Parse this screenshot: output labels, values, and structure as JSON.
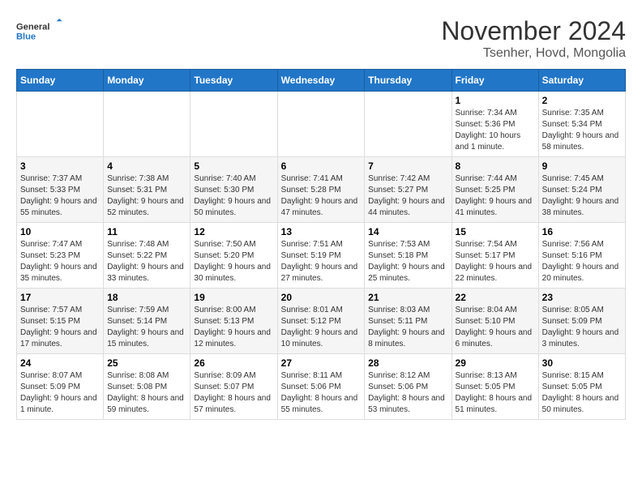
{
  "header": {
    "logo_line1": "General",
    "logo_line2": "Blue",
    "month": "November 2024",
    "location": "Tsenher, Hovd, Mongolia"
  },
  "weekdays": [
    "Sunday",
    "Monday",
    "Tuesday",
    "Wednesday",
    "Thursday",
    "Friday",
    "Saturday"
  ],
  "weeks": [
    [
      {
        "day": "",
        "info": ""
      },
      {
        "day": "",
        "info": ""
      },
      {
        "day": "",
        "info": ""
      },
      {
        "day": "",
        "info": ""
      },
      {
        "day": "",
        "info": ""
      },
      {
        "day": "1",
        "info": "Sunrise: 7:34 AM\nSunset: 5:36 PM\nDaylight: 10 hours and 1 minute."
      },
      {
        "day": "2",
        "info": "Sunrise: 7:35 AM\nSunset: 5:34 PM\nDaylight: 9 hours and 58 minutes."
      }
    ],
    [
      {
        "day": "3",
        "info": "Sunrise: 7:37 AM\nSunset: 5:33 PM\nDaylight: 9 hours and 55 minutes."
      },
      {
        "day": "4",
        "info": "Sunrise: 7:38 AM\nSunset: 5:31 PM\nDaylight: 9 hours and 52 minutes."
      },
      {
        "day": "5",
        "info": "Sunrise: 7:40 AM\nSunset: 5:30 PM\nDaylight: 9 hours and 50 minutes."
      },
      {
        "day": "6",
        "info": "Sunrise: 7:41 AM\nSunset: 5:28 PM\nDaylight: 9 hours and 47 minutes."
      },
      {
        "day": "7",
        "info": "Sunrise: 7:42 AM\nSunset: 5:27 PM\nDaylight: 9 hours and 44 minutes."
      },
      {
        "day": "8",
        "info": "Sunrise: 7:44 AM\nSunset: 5:25 PM\nDaylight: 9 hours and 41 minutes."
      },
      {
        "day": "9",
        "info": "Sunrise: 7:45 AM\nSunset: 5:24 PM\nDaylight: 9 hours and 38 minutes."
      }
    ],
    [
      {
        "day": "10",
        "info": "Sunrise: 7:47 AM\nSunset: 5:23 PM\nDaylight: 9 hours and 35 minutes."
      },
      {
        "day": "11",
        "info": "Sunrise: 7:48 AM\nSunset: 5:22 PM\nDaylight: 9 hours and 33 minutes."
      },
      {
        "day": "12",
        "info": "Sunrise: 7:50 AM\nSunset: 5:20 PM\nDaylight: 9 hours and 30 minutes."
      },
      {
        "day": "13",
        "info": "Sunrise: 7:51 AM\nSunset: 5:19 PM\nDaylight: 9 hours and 27 minutes."
      },
      {
        "day": "14",
        "info": "Sunrise: 7:53 AM\nSunset: 5:18 PM\nDaylight: 9 hours and 25 minutes."
      },
      {
        "day": "15",
        "info": "Sunrise: 7:54 AM\nSunset: 5:17 PM\nDaylight: 9 hours and 22 minutes."
      },
      {
        "day": "16",
        "info": "Sunrise: 7:56 AM\nSunset: 5:16 PM\nDaylight: 9 hours and 20 minutes."
      }
    ],
    [
      {
        "day": "17",
        "info": "Sunrise: 7:57 AM\nSunset: 5:15 PM\nDaylight: 9 hours and 17 minutes."
      },
      {
        "day": "18",
        "info": "Sunrise: 7:59 AM\nSunset: 5:14 PM\nDaylight: 9 hours and 15 minutes."
      },
      {
        "day": "19",
        "info": "Sunrise: 8:00 AM\nSunset: 5:13 PM\nDaylight: 9 hours and 12 minutes."
      },
      {
        "day": "20",
        "info": "Sunrise: 8:01 AM\nSunset: 5:12 PM\nDaylight: 9 hours and 10 minutes."
      },
      {
        "day": "21",
        "info": "Sunrise: 8:03 AM\nSunset: 5:11 PM\nDaylight: 9 hours and 8 minutes."
      },
      {
        "day": "22",
        "info": "Sunrise: 8:04 AM\nSunset: 5:10 PM\nDaylight: 9 hours and 6 minutes."
      },
      {
        "day": "23",
        "info": "Sunrise: 8:05 AM\nSunset: 5:09 PM\nDaylight: 9 hours and 3 minutes."
      }
    ],
    [
      {
        "day": "24",
        "info": "Sunrise: 8:07 AM\nSunset: 5:09 PM\nDaylight: 9 hours and 1 minute."
      },
      {
        "day": "25",
        "info": "Sunrise: 8:08 AM\nSunset: 5:08 PM\nDaylight: 8 hours and 59 minutes."
      },
      {
        "day": "26",
        "info": "Sunrise: 8:09 AM\nSunset: 5:07 PM\nDaylight: 8 hours and 57 minutes."
      },
      {
        "day": "27",
        "info": "Sunrise: 8:11 AM\nSunset: 5:06 PM\nDaylight: 8 hours and 55 minutes."
      },
      {
        "day": "28",
        "info": "Sunrise: 8:12 AM\nSunset: 5:06 PM\nDaylight: 8 hours and 53 minutes."
      },
      {
        "day": "29",
        "info": "Sunrise: 8:13 AM\nSunset: 5:05 PM\nDaylight: 8 hours and 51 minutes."
      },
      {
        "day": "30",
        "info": "Sunrise: 8:15 AM\nSunset: 5:05 PM\nDaylight: 8 hours and 50 minutes."
      }
    ]
  ]
}
